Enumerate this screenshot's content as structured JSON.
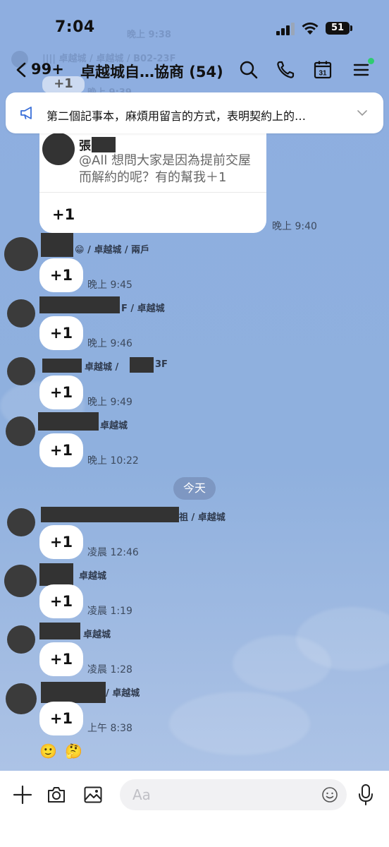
{
  "status_bar": {
    "time": "7:04",
    "battery": "51"
  },
  "ghost": {
    "time": "晚上 9:38",
    "line": "|||| 卓越城 / 卓越城 / B02-23F",
    "bubble_text": "+1",
    "time2": "晚上 9:39"
  },
  "header": {
    "back_count": "99+",
    "title": "卓越城自…協商 (54)",
    "calendar_day": "31"
  },
  "announcement": {
    "text": "第二個記事本，麻煩用留言的方式，表明契約上的…"
  },
  "quoted_message": {
    "name": "張",
    "text": "@All 想問大家是因為提前交屋而解約的呢？有的幫我＋1",
    "reply": "+1",
    "time": "晚上 9:40"
  },
  "messages": [
    {
      "sender_suffix": "😁 / 卓越城 / 兩戶",
      "text": "+1",
      "time": "晚上 9:45"
    },
    {
      "sender_suffix": "F / 卓越城",
      "text": "+1",
      "time": "晚上 9:46"
    },
    {
      "sender_suffix": "卓越城 /",
      "sender_suffix2": "3F",
      "text": "+1",
      "time": "晚上 9:49"
    },
    {
      "sender_suffix": "卓越城",
      "text": "+1",
      "time": "晚上 10:22"
    },
    {
      "sender_suffix": "祖 / 卓越城",
      "text": "+1",
      "time": "凌晨 12:46"
    },
    {
      "sender_suffix": "卓越城",
      "text": "+1",
      "time": "凌晨 1:19"
    },
    {
      "sender_suffix": "卓越城",
      "text": "+1",
      "time": "凌晨 1:28"
    },
    {
      "sender_suffix": "/ 卓越城",
      "text": "+1",
      "time": "上午 8:38"
    }
  ],
  "date_separator": "今天",
  "reactions": {
    "smile": "🙂",
    "thinking": "🤔"
  },
  "composer": {
    "placeholder": "Aa"
  }
}
